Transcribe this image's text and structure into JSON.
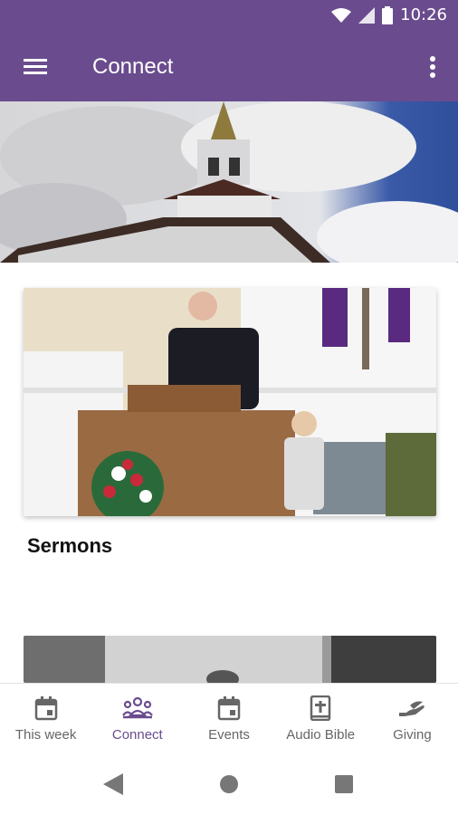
{
  "status_bar": {
    "time": "10:26"
  },
  "app_bar": {
    "title": "Connect"
  },
  "cards": [
    {
      "title": "Sermons"
    },
    {
      "title": ""
    }
  ],
  "bottom_nav": {
    "items": [
      {
        "label": "This week",
        "icon": "calendar-icon"
      },
      {
        "label": "Connect",
        "icon": "people-icon",
        "active": true
      },
      {
        "label": "Events",
        "icon": "calendar-icon"
      },
      {
        "label": "Audio Bible",
        "icon": "bible-icon"
      },
      {
        "label": "Giving",
        "icon": "hand-icon"
      }
    ]
  },
  "colors": {
    "primary": "#6a4c8e",
    "inactive": "#666666"
  }
}
